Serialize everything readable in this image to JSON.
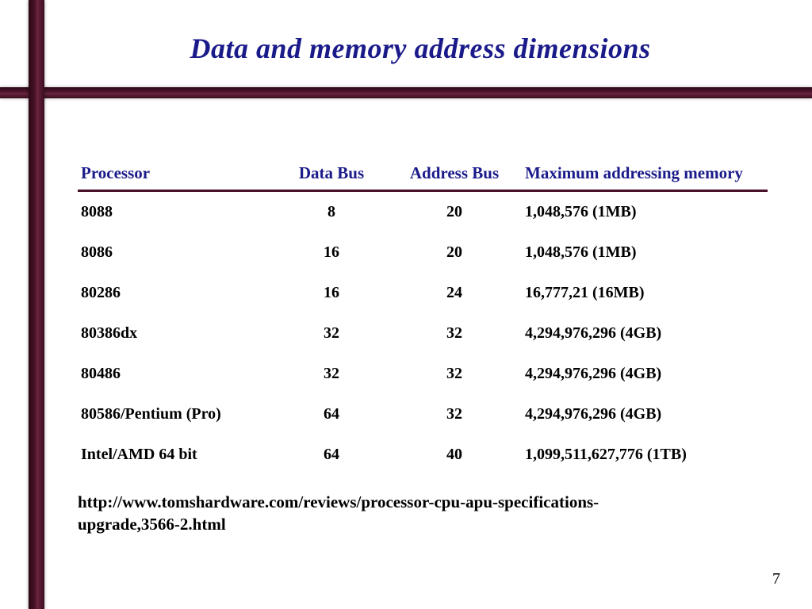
{
  "title": "Data and memory address dimensions",
  "headers": {
    "processor": "Processor",
    "data_bus": "Data Bus",
    "address_bus": "Address Bus",
    "max_mem": "Maximum addressing memory"
  },
  "rows": [
    {
      "processor": "8088",
      "data_bus": "8",
      "address_bus": "20",
      "max_mem": "1,048,576    (1MB)"
    },
    {
      "processor": "8086",
      "data_bus": "16",
      "address_bus": "20",
      "max_mem": "1,048,576    (1MB)"
    },
    {
      "processor": "80286",
      "data_bus": "16",
      "address_bus": "24",
      "max_mem": "16,777,21    (16MB)"
    },
    {
      "processor": "80386dx",
      "data_bus": "32",
      "address_bus": "32",
      "max_mem": "4,294,976,296  (4GB)"
    },
    {
      "processor": "80486",
      "data_bus": "32",
      "address_bus": "32",
      "max_mem": "4,294,976,296  (4GB)"
    },
    {
      "processor": "80586/Pentium (Pro)",
      "data_bus": "64",
      "address_bus": "32",
      "max_mem": "4,294,976,296  (4GB)"
    },
    {
      "processor": "Intel/AMD 64 bit",
      "data_bus": "64",
      "address_bus": "40",
      "max_mem": "1,099,511,627,776 (1TB)"
    }
  ],
  "source": "http://www.tomshardware.com/reviews/processor-cpu-apu-specifications-upgrade,3566-2.html",
  "page_number": "7"
}
